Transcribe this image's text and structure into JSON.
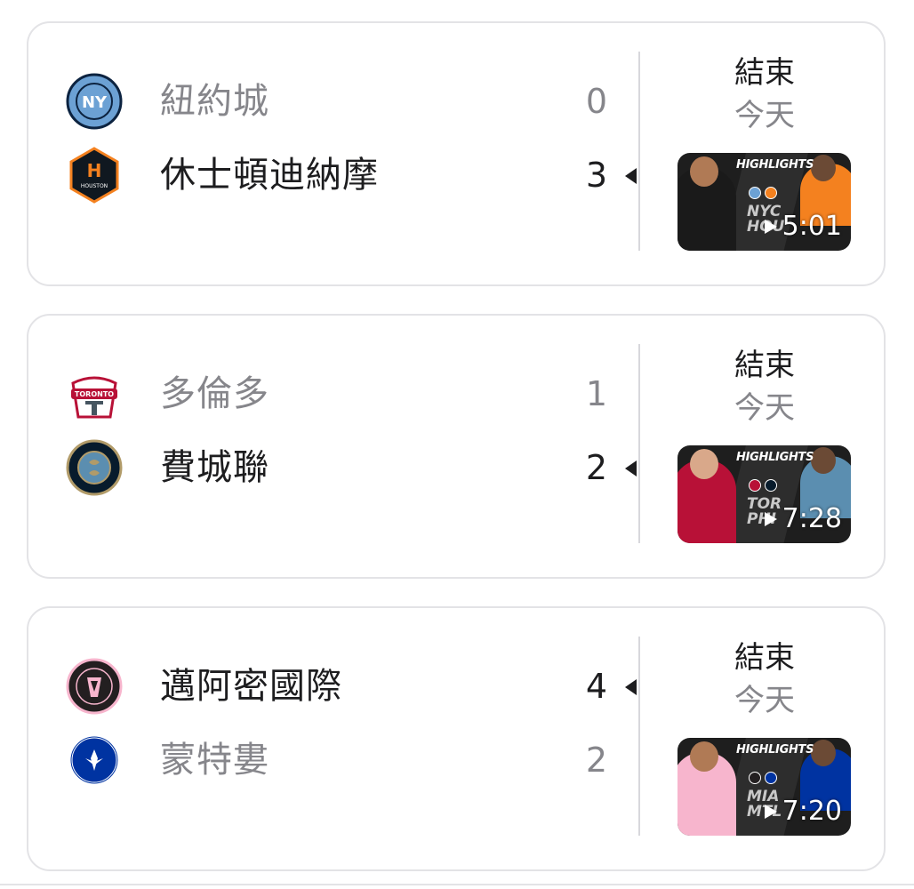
{
  "matches": [
    {
      "home": {
        "name": "紐約城",
        "score": "0",
        "logo_icon": "nycfc-logo-icon",
        "color": "#6ca1d4"
      },
      "away": {
        "name": "休士頓迪納摩",
        "score": "3",
        "logo_icon": "houston-dynamo-logo-icon",
        "color": "#f4811f"
      },
      "winner": "away",
      "status": "結束",
      "when": "今天",
      "video": {
        "duration": "5:01",
        "headline": "HIGHLIGHTS",
        "abbr_top": "NYC",
        "abbr_bottom": "HOU"
      }
    },
    {
      "home": {
        "name": "多倫多",
        "score": "1",
        "logo_icon": "toronto-fc-logo-icon",
        "color": "#b81137"
      },
      "away": {
        "name": "費城聯",
        "score": "2",
        "logo_icon": "philadelphia-union-logo-icon",
        "color": "#071b2c"
      },
      "winner": "away",
      "status": "結束",
      "when": "今天",
      "video": {
        "duration": "7:28",
        "headline": "HIGHLIGHTS",
        "abbr_top": "TOR",
        "abbr_bottom": "PHI"
      }
    },
    {
      "home": {
        "name": "邁阿密國際",
        "score": "4",
        "logo_icon": "inter-miami-logo-icon",
        "color": "#f7b5cd"
      },
      "away": {
        "name": "蒙特婁",
        "score": "2",
        "logo_icon": "cf-montreal-logo-icon",
        "color": "#0033a1"
      },
      "winner": "home",
      "status": "結束",
      "when": "今天",
      "video": {
        "duration": "7:20",
        "headline": "HIGHLIGHTS",
        "abbr_top": "MIA",
        "abbr_bottom": "MTL"
      }
    }
  ]
}
